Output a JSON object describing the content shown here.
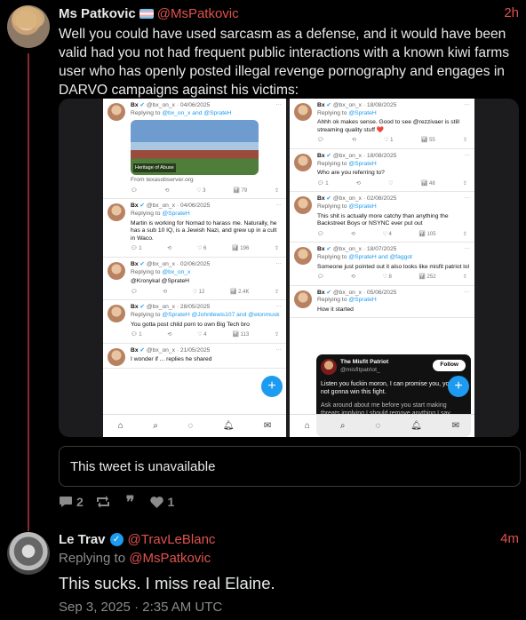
{
  "post1": {
    "display_name": "Ms Patkovic",
    "flag_icon": "transgender-flag",
    "handle": "@MsPatkovic",
    "time": "2h",
    "text": "Well you could have used sarcasm as a defense, and it would have been valid had you not had frequent public interactions with a known kiwi farms user who has openly posted illegal revenge pornography and engages in DARVO campaigns against his victims:",
    "quote_unavailable": "This tweet is unavailable",
    "stats": {
      "replies": "2",
      "retweets": "",
      "quotes": "",
      "likes": "1"
    }
  },
  "screenshot_left": {
    "tweets": [
      {
        "name": "Bx",
        "meta": "@bx_on_x · 04/06/2025",
        "reply_prefix": "Replying to",
        "reply_to": "@bx_on_x and @SprateH",
        "text": "",
        "image_caption": "Heritage of Abuse",
        "source": "From texasobserver.org",
        "acts": [
          "",
          "",
          "3",
          "79",
          ""
        ]
      },
      {
        "name": "Bx",
        "meta": "@bx_on_x · 04/06/2025",
        "reply_prefix": "Replying to",
        "reply_to": "@SprateH",
        "text": "Martin is working for Nomad to harass me. Naturally, he has a sub 10 IQ, is a Jewish Nazi, and grew up in a cult in Waco.",
        "acts": [
          "1",
          "",
          "6",
          "196",
          ""
        ]
      },
      {
        "name": "Bx",
        "meta": "@bx_on_x · 02/06/2025",
        "reply_prefix": "Replying to",
        "reply_to": "@bx_on_x",
        "text": "@Kronykal @SprateH",
        "acts": [
          "",
          "",
          "12",
          "2.4K",
          ""
        ]
      },
      {
        "name": "Bx",
        "meta": "@bx_on_x · 28/05/2025",
        "reply_prefix": "Replying to",
        "reply_to": "@SprateH @Johnllewis107 and @elonmusk",
        "text": "You gotta post child porn to own Big Tech bro",
        "acts": [
          "1",
          "",
          "4",
          "113",
          ""
        ]
      },
      {
        "name": "Bx",
        "meta": "@bx_on_x · 21/05/2025",
        "reply_prefix": "",
        "reply_to": "",
        "text": "I wonder if ... replies he shared",
        "acts": []
      }
    ]
  },
  "screenshot_right": {
    "tweets": [
      {
        "name": "Bx",
        "meta": "@bx_on_x · 18/08/2025",
        "reply_prefix": "Replying to",
        "reply_to": "@SprateH",
        "text": "Ahhh ok makes sense. Good to see @rezzivaer is still streaming quality stuff ❤️",
        "acts": [
          "",
          "",
          "1",
          "55",
          ""
        ]
      },
      {
        "name": "Bx",
        "meta": "@bx_on_x · 18/08/2025",
        "reply_prefix": "Replying to",
        "reply_to": "@SprateH",
        "text": "Who are you referring to?",
        "acts": [
          "1",
          "",
          "",
          "48",
          ""
        ]
      },
      {
        "name": "Bx",
        "meta": "@bx_on_x · 02/08/2025",
        "reply_prefix": "Replying to",
        "reply_to": "@SprateH",
        "text": "This shit is actually more catchy than anything the Backstreet Boys or NSYNC ever put out",
        "acts": [
          "",
          "",
          "4",
          "105",
          ""
        ]
      },
      {
        "name": "Bx",
        "meta": "@bx_on_x · 18/07/2025",
        "reply_prefix": "Replying to",
        "reply_to": "@SprateH and @faggot",
        "text": "Someone just pointed out it also looks like misfit patriot lol",
        "acts": [
          "",
          "",
          "8",
          "252",
          ""
        ]
      },
      {
        "name": "Bx",
        "meta": "@bx_on_x · 05/06/2025",
        "reply_prefix": "Replying to",
        "reply_to": "@SprateH",
        "text": "How it started",
        "acts": []
      }
    ],
    "embedded_card": {
      "name": "The Misfit Patriot",
      "handle": "@misfitpatriot_",
      "follow_label": "Follow",
      "text1": "Listen you fuckin moron, I can promise you, you're not gonna win this fight.",
      "text2": "Ask around about me before you start making threats implying I should remove anything I say"
    }
  },
  "post2": {
    "display_name": "Le Trav",
    "handle": "@TravLeBlanc",
    "time": "4m",
    "reply_prefix": "Replying to",
    "reply_to": "@MsPatkovic",
    "text": "This sucks. I miss real Elaine.",
    "date": "Sep 3, 2025 · 2:35 AM UTC"
  },
  "colors": {
    "accent": "#e0524f",
    "background": "#000000",
    "text": "#e7e9ea",
    "muted": "#8b8b8b",
    "verified": "#1d9bf0"
  }
}
